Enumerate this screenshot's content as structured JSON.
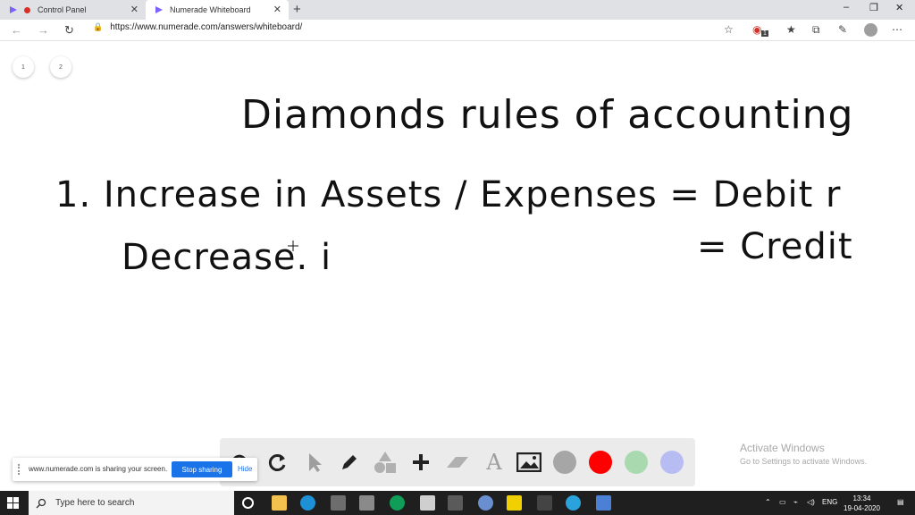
{
  "browser": {
    "tabs": [
      {
        "label": "Control Panel",
        "active": false
      },
      {
        "label": "Numerade Whiteboard",
        "active": true
      }
    ],
    "new_tab_symbol": "+",
    "url": "https://www.numerade.com/answers/whiteboard/",
    "window_controls": [
      "–",
      "❐",
      "✕"
    ],
    "profile_badge": "1"
  },
  "pages": [
    "1",
    "2"
  ],
  "whiteboard": {
    "title": "Diamonds rules of accounting",
    "line1": "1. Increase in Assets / Expenses = Debit r",
    "line2_left": "Decrease. i",
    "line2_right": "= Credit"
  },
  "draw_toolbar": {
    "tools": [
      "undo-icon",
      "redo-icon",
      "pointer-icon",
      "pen-icon",
      "shapes-icon",
      "plus-icon",
      "eraser-icon",
      "text-icon",
      "image-icon"
    ],
    "text_tool_glyph": "A",
    "colors": [
      "#a6a6a6",
      "#ff0000",
      "#a9d9ae",
      "#b7bdf3"
    ]
  },
  "share_notice": {
    "message": "www.numerade.com is sharing your screen.",
    "stop_label": "Stop sharing",
    "hide_label": "Hide"
  },
  "activation": {
    "title": "Activate Windows",
    "subtitle": "Go to Settings to activate Windows."
  },
  "taskbar": {
    "search_placeholder": "Type here to search",
    "language": "ENG",
    "time": "13:34",
    "date": "19-04-2020"
  }
}
